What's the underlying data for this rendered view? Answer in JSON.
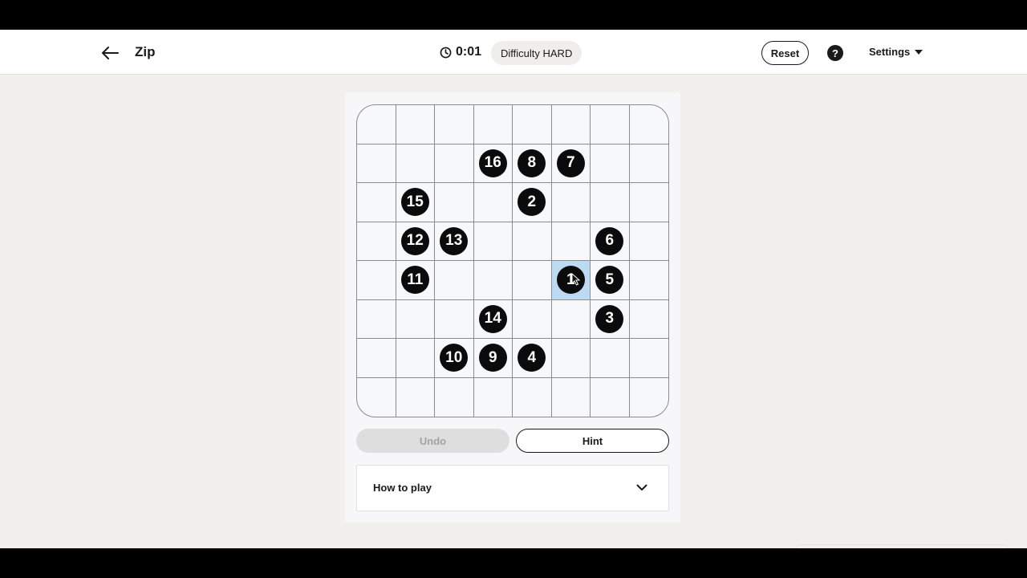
{
  "header": {
    "title": "Zip",
    "timer": "0:01",
    "difficulty": "Difficulty HARD",
    "reset_label": "Reset",
    "help_glyph": "?",
    "settings_label": "Settings"
  },
  "board": {
    "rows": 8,
    "cols": 8,
    "active_cell": [
      4,
      5
    ],
    "clues": [
      {
        "row": 1,
        "col": 3,
        "number": "16"
      },
      {
        "row": 1,
        "col": 4,
        "number": "8"
      },
      {
        "row": 1,
        "col": 5,
        "number": "7"
      },
      {
        "row": 2,
        "col": 1,
        "number": "15"
      },
      {
        "row": 2,
        "col": 4,
        "number": "2"
      },
      {
        "row": 3,
        "col": 1,
        "number": "12"
      },
      {
        "row": 3,
        "col": 2,
        "number": "13"
      },
      {
        "row": 3,
        "col": 6,
        "number": "6"
      },
      {
        "row": 4,
        "col": 1,
        "number": "11"
      },
      {
        "row": 4,
        "col": 5,
        "number": "1"
      },
      {
        "row": 4,
        "col": 6,
        "number": "5"
      },
      {
        "row": 5,
        "col": 3,
        "number": "14"
      },
      {
        "row": 5,
        "col": 6,
        "number": "3"
      },
      {
        "row": 6,
        "col": 2,
        "number": "10"
      },
      {
        "row": 6,
        "col": 3,
        "number": "9"
      },
      {
        "row": 6,
        "col": 4,
        "number": "4"
      }
    ]
  },
  "controls": {
    "undo_label": "Undo",
    "hint_label": "Hint"
  },
  "how_to_play": {
    "label": "How to play"
  },
  "colors": {
    "clue_bg": "#0b0b0b",
    "active_cell": "#bcdaf2",
    "page_bg": "#f1f0ec"
  },
  "icons": {
    "back": "arrow-left-icon",
    "timer": "clock-icon",
    "help": "question-icon",
    "settings": "caret-down-icon",
    "how_to_play": "chevron-down-icon"
  }
}
